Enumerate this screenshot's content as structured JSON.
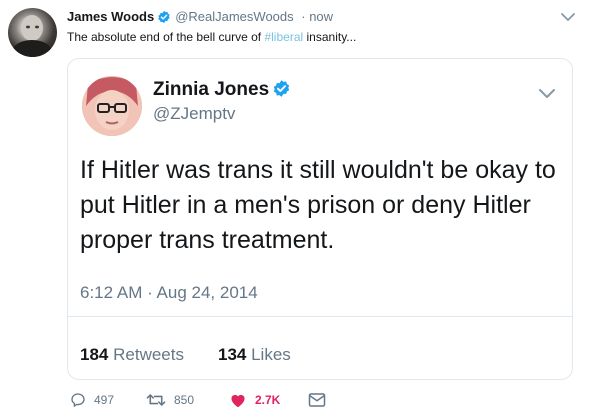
{
  "outer_tweet": {
    "author_name": "James Woods",
    "handle": "@RealJamesWoods",
    "time": "· now",
    "text_before": "The absolute end of the bell curve of ",
    "hashtag": "#liberal",
    "text_after": " insanity...",
    "verified": true
  },
  "quoted_tweet": {
    "author_name": "Zinnia Jones",
    "handle": "@ZJemptv",
    "text": "If Hitler was trans it still wouldn't be okay to put Hitler in a men's prison or deny Hitler proper trans treatment.",
    "timestamp": "6:12 AM · Aug 24, 2014",
    "retweets_count": "184",
    "retweets_label": "Retweets",
    "likes_count": "134",
    "likes_label": "Likes",
    "verified": true
  },
  "actions": {
    "reply_count": "497",
    "retweet_count": "850",
    "like_count": "2.7K"
  },
  "colors": {
    "verified_blue": "#1da1f2",
    "hashtag_blue": "#7ac3df",
    "like_red": "#e0245e",
    "muted_gray": "#657786"
  }
}
